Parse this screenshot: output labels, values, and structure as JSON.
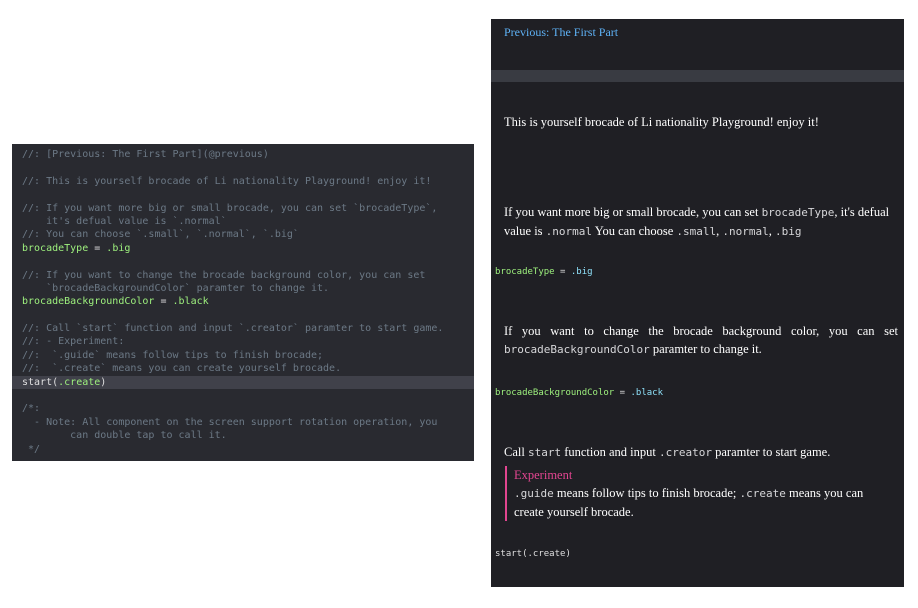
{
  "editor": {
    "lines": [
      {
        "k": "c",
        "t": "//: [Previous: The First Part](@previous)"
      },
      {
        "k": "c",
        "t": ""
      },
      {
        "k": "c",
        "t": "//: This is yourself brocade of Li nationality Playground! enjoy it!"
      },
      {
        "k": "c",
        "t": ""
      },
      {
        "k": "c",
        "t": "//: If you want more big or small brocade, you can set `brocadeType`,"
      },
      {
        "k": "c",
        "t": "    it's defual value is `.normal`"
      },
      {
        "k": "c",
        "t": "//: You can choose `.small`, `.normal`, `.big`"
      },
      {
        "k": "code",
        "a": "brocadeType",
        "b": " = ",
        "c": ".big"
      },
      {
        "k": "c",
        "t": ""
      },
      {
        "k": "c",
        "t": "//: If you want to change the brocade background color, you can set"
      },
      {
        "k": "c",
        "t": "    `brocadeBackgroundColor` paramter to change it."
      },
      {
        "k": "code",
        "a": "brocadeBackgroundColor",
        "b": " = ",
        "c": ".black"
      },
      {
        "k": "c",
        "t": ""
      },
      {
        "k": "c",
        "t": "//: Call `start` function and input `.creator` paramter to start game."
      },
      {
        "k": "c",
        "t": "//: - Experiment:"
      },
      {
        "k": "c",
        "t": "//:  `.guide` means follow tips to finish brocade;"
      },
      {
        "k": "c",
        "t": "//:  `.create` means you can create yourself brocade."
      },
      {
        "k": "call",
        "a": "start",
        "b": "(",
        "c": ".create",
        "d": ")"
      },
      {
        "k": "c",
        "t": ""
      },
      {
        "k": "c",
        "t": "/*:"
      },
      {
        "k": "c",
        "t": "  - Note: All component on the screen support rotation operation, you"
      },
      {
        "k": "c",
        "t": "        can double tap to call it."
      },
      {
        "k": "c",
        "t": " */"
      }
    ]
  },
  "rendered": {
    "nav_link": "Previous: The First Part",
    "intro": "This is yourself brocade of Li nationality Playground! enjoy it!",
    "p1": {
      "t1": "If you want more big or small brocade, you can set ",
      "c1": "brocadeType",
      "t2": ", it's defual value is ",
      "c2": ".normal",
      "t3": " You can choose ",
      "c3": ".small",
      "t4": ", ",
      "c4": ".normal",
      "t5": ", ",
      "c5": ".big"
    },
    "code1": {
      "var": "brocadeType",
      "op": " = ",
      "val": ".big"
    },
    "p2": {
      "t1": "If you want to change the brocade background color, you can set ",
      "c1": "brocadeBackgroundColor",
      "t2": " paramter to change it."
    },
    "code2": {
      "var": "brocadeBackgroundColor",
      "op": " = ",
      "val": ".black"
    },
    "p3": {
      "t1": "Call ",
      "c1": "start",
      "t2": " function and input ",
      "c2": ".creator",
      "t3": " paramter to start game."
    },
    "experiment": {
      "title": "Experiment",
      "c1": ".guide",
      "t1": " means follow tips to finish brocade; ",
      "c2": ".create",
      "t2": " means you can create yourself brocade."
    },
    "code3": "start(.create)"
  }
}
